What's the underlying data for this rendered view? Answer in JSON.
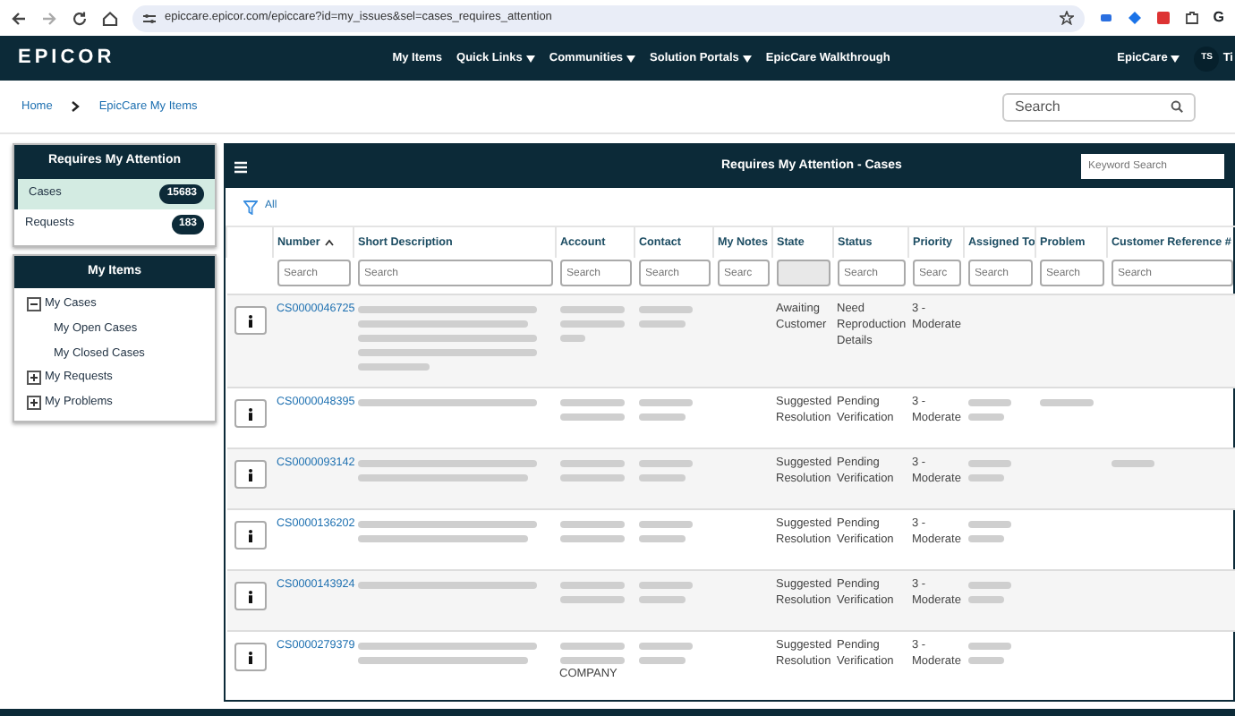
{
  "browser": {
    "url": "epiccare.epicor.com/epiccare?id=my_issues&sel=cases_requires_attention",
    "profile": "G"
  },
  "navbar": {
    "logo": "EPICOR",
    "links": [
      {
        "label": "My Items",
        "dropdown": false
      },
      {
        "label": "Quick Links",
        "dropdown": true
      },
      {
        "label": "Communities",
        "dropdown": true
      },
      {
        "label": "Solution Portals",
        "dropdown": true
      },
      {
        "label": "EpicCare Walkthrough",
        "dropdown": false
      }
    ],
    "menu": {
      "label": "EpicCare",
      "dropdown": true
    },
    "avatar": "TS",
    "user": "Ti"
  },
  "breadcrumb": [
    "Home",
    "EpicCare My Items"
  ],
  "search": {
    "placeholder": "Search"
  },
  "attention": {
    "title": "Requires My Attention",
    "items": [
      {
        "label": "Cases",
        "count": "15683",
        "selected": true
      },
      {
        "label": "Requests",
        "count": "183",
        "selected": false
      }
    ]
  },
  "my_items": {
    "title": "My Items",
    "tree": [
      {
        "label": "My Cases",
        "expanded": true,
        "children": [
          {
            "label": "My Open Cases"
          },
          {
            "label": "My Closed Cases"
          }
        ]
      },
      {
        "label": "My Requests",
        "expanded": false
      },
      {
        "label": "My Problems",
        "expanded": false
      }
    ]
  },
  "panel": {
    "title": "Requires My Attention - Cases",
    "keyword_placeholder": "Keyword Search",
    "filter": "All"
  },
  "table": {
    "columns": [
      {
        "label": "Number",
        "sorted": true,
        "placeholder": "Search"
      },
      {
        "label": "Short Description",
        "sorted": false,
        "placeholder": "Search"
      },
      {
        "label": "Account",
        "sorted": false,
        "placeholder": "Search"
      },
      {
        "label": "Contact",
        "sorted": false,
        "placeholder": "Search"
      },
      {
        "label": "My Notes",
        "sorted": false,
        "placeholder": "Searc"
      },
      {
        "label": "State",
        "sorted": false,
        "disabled": true
      },
      {
        "label": "Status",
        "sorted": false,
        "placeholder": "Search"
      },
      {
        "label": "Priority",
        "sorted": false,
        "placeholder": "Searc"
      },
      {
        "label": "Assigned To",
        "sorted": false,
        "placeholder": "Search"
      },
      {
        "label": "Problem",
        "sorted": false,
        "placeholder": "Search"
      },
      {
        "label": "Customer Reference #",
        "sorted": false,
        "placeholder": "Search"
      }
    ],
    "rows": [
      {
        "cells": [
          "CS0000046725",
          {
            "redacted": true
          },
          {
            "redacted": true
          },
          {
            "redacted": true
          },
          null,
          "Awaiting Customer",
          "Need Reproduction Details",
          "3 - Moderate",
          null,
          null,
          null
        ]
      },
      {
        "cells": [
          "CS0000048395",
          {
            "redacted": true
          },
          {
            "redacted": true
          },
          {
            "redacted": true
          },
          null,
          "Suggested Resolution",
          "Pending Verification",
          "3 - Moderate",
          {
            "redacted": true
          },
          {
            "redacted": true
          },
          null
        ]
      },
      {
        "cells": [
          "CS0000093142",
          {
            "redacted": true
          },
          {
            "redacted": true
          },
          {
            "redacted": true
          },
          null,
          "Suggested Resolution",
          "Pending Verification",
          "3 - Moderate",
          {
            "redacted": true
          },
          null,
          {
            "redacted": true
          }
        ]
      },
      {
        "cells": [
          "CS0000136202",
          {
            "redacted": true
          },
          {
            "redacted": true
          },
          {
            "redacted": true
          },
          null,
          "Suggested Resolution",
          "Pending Verification",
          "3 - Moderate",
          {
            "redacted": true
          },
          null,
          null
        ]
      },
      {
        "cells": [
          "CS0000143924",
          {
            "redacted": true
          },
          {
            "redacted": true
          },
          {
            "redacted": true
          },
          null,
          "Suggested Resolution",
          "Pending Verification",
          "3 - Moderate",
          {
            "redacted": true
          },
          null,
          null
        ]
      },
      {
        "cells": [
          "CS0000279379",
          {
            "redacted": true
          },
          {
            "redacted": true,
            "text": "COMPANY"
          },
          {
            "redacted": true
          },
          null,
          "Suggested Resolution",
          "Pending Verification",
          "3 - Moderate",
          {
            "redacted": true
          },
          null,
          null
        ]
      }
    ]
  }
}
